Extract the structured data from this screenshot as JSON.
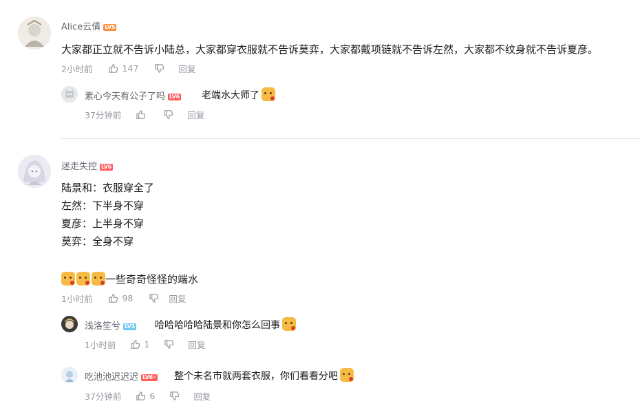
{
  "comments": [
    {
      "user": "Alice云倩",
      "level": "LV5",
      "text": "大家都正立就不告诉小陆总，大家都穿衣服就不告诉莫弈，大家都戴项链就不告诉左然，大家都不纹身就不告诉夏彦。",
      "time": "2小时前",
      "likes": "147",
      "reply_label": "回复",
      "replies": [
        {
          "user": "素心今天有公子了吗",
          "level": "LV6",
          "text": "老端水大师了",
          "time": "37分钟前",
          "likes": "",
          "reply_label": "回复"
        }
      ]
    },
    {
      "user": "迷走失控",
      "level": "LV6",
      "lines": [
        "陆景和：衣服穿全了",
        "左然：下半身不穿",
        "夏彦：上半身不穿",
        "莫弈：全身不穿"
      ],
      "last_line": "一些奇奇怪怪的端水",
      "time": "1小时前",
      "likes": "98",
      "reply_label": "回复",
      "replies": [
        {
          "user": "浅洛笙兮",
          "level": "LV3",
          "text": "哈哈哈哈哈陆景和你怎么回事",
          "time": "1小时前",
          "likes": "1",
          "reply_label": "回复"
        },
        {
          "user": "吃池池迟迟迟",
          "level": "LV6⚡",
          "text": "整个未名市就两套衣服，你们看看分吧",
          "time": "37分钟前",
          "likes": "6",
          "reply_label": "回复"
        }
      ]
    }
  ],
  "icons": {
    "like": "thumb-up-icon",
    "dislike": "thumb-down-icon",
    "emoji": "doge-emoji"
  },
  "colors": {
    "lv5": "#ff8f3f",
    "lv6": "#ff5b5b",
    "lv3": "#6ec9f4",
    "meta": "#9499a0"
  }
}
